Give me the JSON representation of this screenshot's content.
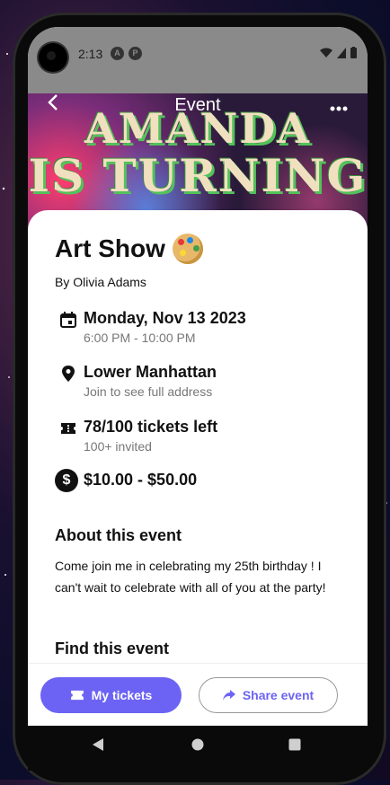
{
  "status_bar": {
    "time": "2:13",
    "icon_a": "A",
    "icon_b": "P"
  },
  "header": {
    "title": "Event",
    "banner_line1": "AMANDA",
    "banner_line2": "IS TURNING"
  },
  "event": {
    "title": "Art Show",
    "organizer": "By Olivia Adams",
    "date": "Monday, Nov 13 2023",
    "time_range": "6:00 PM - 10:00 PM",
    "location": "Lower Manhattan",
    "location_note": "Join to see full address",
    "tickets": "78/100 tickets left",
    "invited": "100+ invited",
    "price": "$10.00 - $50.00",
    "dollar_symbol": "$"
  },
  "about": {
    "heading": "About this event",
    "text": "Come join me in celebrating my 25th birthday ! I can't wait to celebrate with all of you at the party!"
  },
  "find": {
    "heading": "Find this event"
  },
  "actions": {
    "my_tickets": "My tickets",
    "share_event": "Share event"
  },
  "colors": {
    "accent": "#6c63f5"
  }
}
